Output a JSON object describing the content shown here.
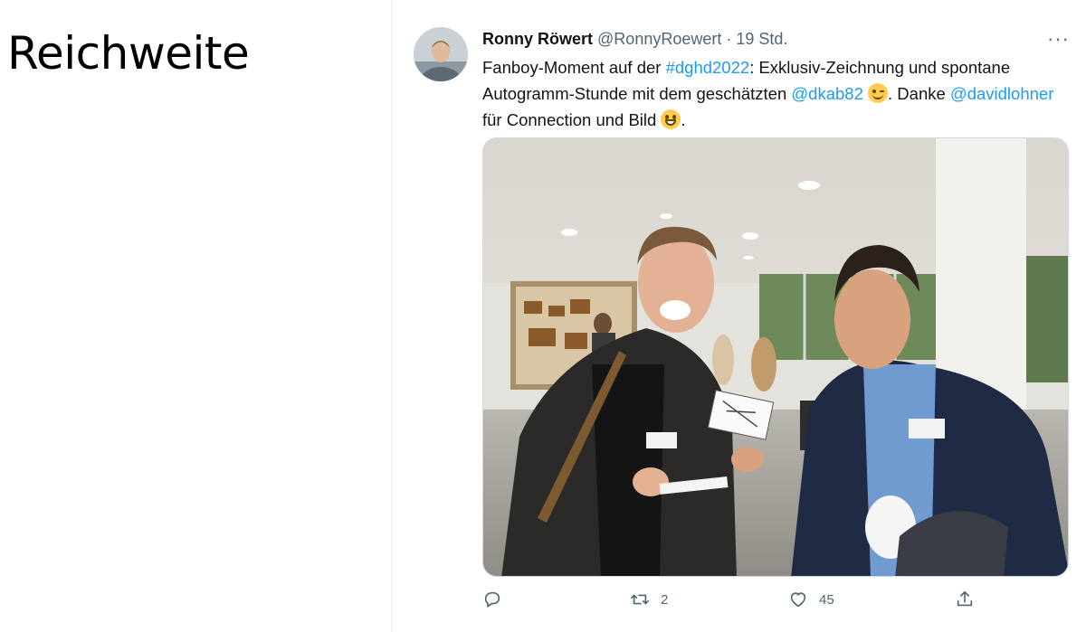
{
  "slide": {
    "title": "Reichweite"
  },
  "tweet": {
    "author_name": "Ronny Röwert",
    "handle": "@RonnyRoewert",
    "separator": "·",
    "time": "19 Std.",
    "more": "···",
    "text": {
      "part1": "Fanboy-Moment auf der ",
      "hashtag": "#dghd2022",
      "part2": ": Exklusiv-Zeichnung und spontane Autogramm-Stunde mit dem geschätzten ",
      "mention1": "@dkab82",
      "part3": ". Danke ",
      "mention2": "@davidlohner",
      "part4": " für Connection und Bild",
      "part5": "."
    },
    "actions": {
      "replies": "",
      "retweets": "2",
      "likes": "45"
    }
  },
  "colors": {
    "link": "#1d9bf0",
    "muted": "#536471",
    "text": "#0f1419"
  },
  "icons": [
    "reply-icon",
    "retweet-icon",
    "like-icon",
    "share-icon",
    "wink-emoji",
    "grin-emoji"
  ]
}
